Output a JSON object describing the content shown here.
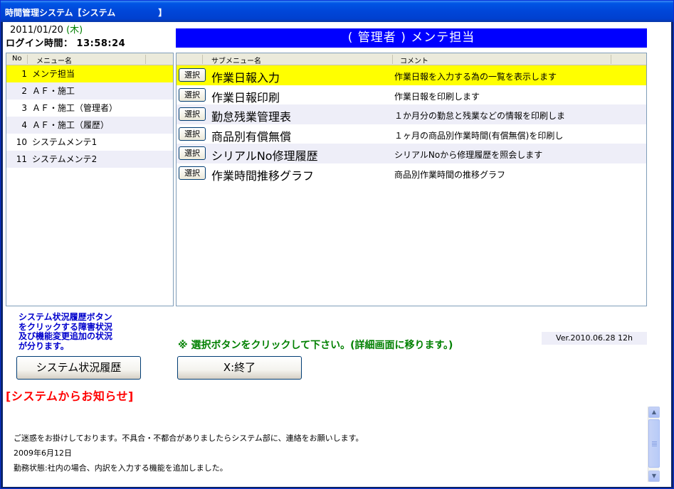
{
  "window": {
    "title": "時間管理システム【システム　　　　　】"
  },
  "status": {
    "date": "2011/01/20",
    "weekday": "(木)",
    "login_label": "ログイン時間：",
    "login_time": "13:58:24"
  },
  "header": {
    "title": "( 管理者 ) メンテ担当"
  },
  "menu": {
    "col_no": "No",
    "col_name": "メニュー名",
    "items": [
      {
        "no": "1",
        "label": "メンテ担当"
      },
      {
        "no": "2",
        "label": "ＡＦ・施工"
      },
      {
        "no": "3",
        "label": "ＡＦ・施工（管理者）"
      },
      {
        "no": "4",
        "label": "ＡＦ・施工（履歴）"
      },
      {
        "no": "10",
        "label": "システムメンテ1"
      },
      {
        "no": "11",
        "label": "システムメンテ2"
      }
    ]
  },
  "submenu": {
    "col_name": "サブメニュー名",
    "col_comment": "コメント",
    "select_label": "選択",
    "items": [
      {
        "name": "作業日報入力",
        "comment": "作業日報を入力する為の一覧を表示します"
      },
      {
        "name": "作業日報印刷",
        "comment": "作業日報を印刷します"
      },
      {
        "name": "勤怠残業管理表",
        "comment": "１か月分の勤怠と残業などの情報を印刷しま"
      },
      {
        "name": "商品別有償無償",
        "comment": "１ヶ月の商品別作業時間(有償無償)を印刷し"
      },
      {
        "name": "シリアルNo修理履歴",
        "comment": "シリアルNoから修理履歴を照会します"
      },
      {
        "name": "作業時間推移グラフ",
        "comment": "商品別作業時間の推移グラフ"
      }
    ]
  },
  "info": {
    "lines": [
      "システム状況履歴ボタン",
      "をクリックする障害状況",
      "及び機能変更追加の状況",
      "が分ります。"
    ]
  },
  "instruction": "※ 選択ボタンをクリックして下さい。(詳細画面に移ります。)",
  "version": "Ver.2010.06.28 12h",
  "buttons": {
    "history": "システム状況履歴",
    "exit": "X:終了"
  },
  "notice": {
    "title": "[システムからお知らせ]",
    "lines": [
      "ご迷惑をお掛けしております。不具合・不都合がありましたらシステム部に、連絡をお願いします。",
      "2009年6月12日",
      "勤務状態:社内の場合、内訳を入力する機能を追加しました。"
    ]
  },
  "colors": {
    "header_bg": "#0000ff",
    "selected_row": "#ffff00",
    "notice_title": "#ff0000",
    "instruction": "#008000",
    "info_text": "#0000cc"
  }
}
